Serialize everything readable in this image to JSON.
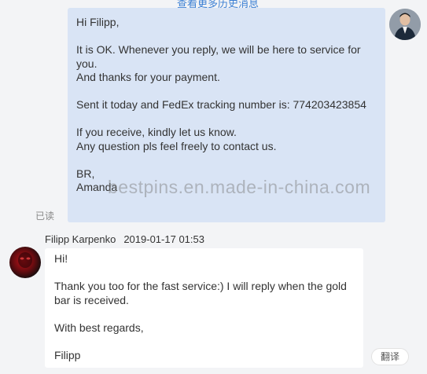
{
  "header": {
    "history_link": "查看更多历史消息"
  },
  "outgoing_message": {
    "lines": [
      "Hi Filipp,",
      "",
      "It is OK. Whenever you reply, we will be here to service for",
      "you.",
      "And thanks for your payment.",
      "",
      "Sent it today and FedEx tracking number is: 774203423854",
      "",
      "If you receive, kindly let us know.",
      "Any question pls feel freely to contact us.",
      "",
      "BR,",
      "Amanda"
    ],
    "read_status": "已读"
  },
  "incoming_message": {
    "sender": "Filipp Karpenko",
    "timestamp": "2019-01-17 01:53",
    "lines": [
      "Hi!",
      "",
      "Thank you too for the fast service:) I will reply when the gold",
      "bar is received.",
      "",
      "With best regards,",
      "",
      "Filipp"
    ]
  },
  "watermark": "bestpins.en.made-in-china.com",
  "translate_button": "翻译",
  "colors": {
    "outgoing_bubble": "#d9e4f5",
    "incoming_bubble": "#ffffff",
    "background": "#f3f4f6",
    "link": "#3b7fd4"
  }
}
